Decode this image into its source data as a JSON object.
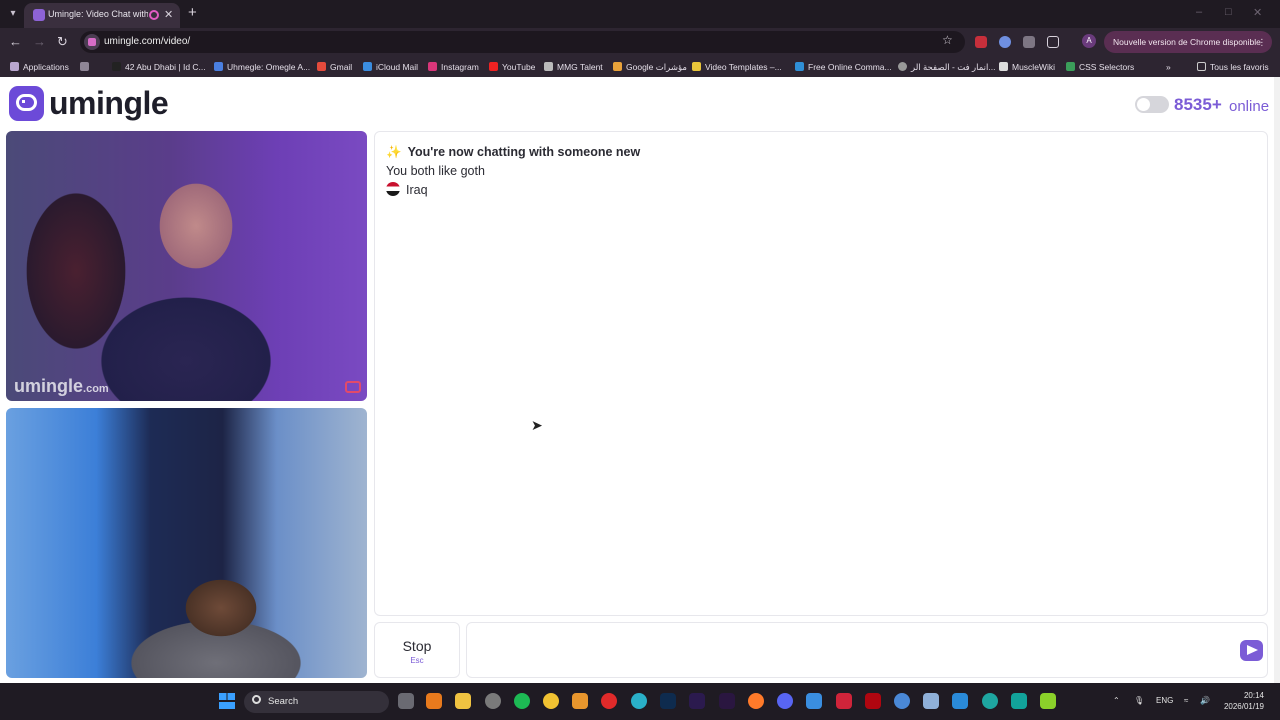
{
  "browser": {
    "tab_title": "Umingle: Video Chat with S",
    "url": "umingle.com/video/",
    "update_label": "Nouvelle version de Chrome disponible",
    "profile_initial": "A"
  },
  "bookmarks": [
    "Applications",
    "42 Abu Dhabi | Id C...",
    "Uhmegle: Omegle A...",
    "Gmail",
    "iCloud Mail",
    "Instagram",
    "YouTube",
    "MMG Talent",
    "Google مؤشرات",
    "Video Templates –...",
    "Free Online Comma...",
    "انمار فت - الصفحة الر...",
    "MuscleWiki",
    "CSS Selectors"
  ],
  "bookmarks_all": "Tous les favoris",
  "site": {
    "logo": "umingle",
    "online_count": "8535+",
    "online_label": "online",
    "watermark": "umingle",
    "watermark_tld": ".com"
  },
  "chat": {
    "intro": "You're now chatting with someone new",
    "common": "You both like goth",
    "country": "Iraq"
  },
  "controls": {
    "stop_label": "Stop",
    "stop_hint": "Esc",
    "message_value": "",
    "message_placeholder": ""
  },
  "taskbar": {
    "search_label": "Search",
    "lang": "ENG",
    "time": "20:14",
    "date": "2026/01/19"
  },
  "colors": {
    "brand": "#7b5cd6",
    "tab_strip": "#1f1a22",
    "taskbar": "#1f1b23"
  }
}
